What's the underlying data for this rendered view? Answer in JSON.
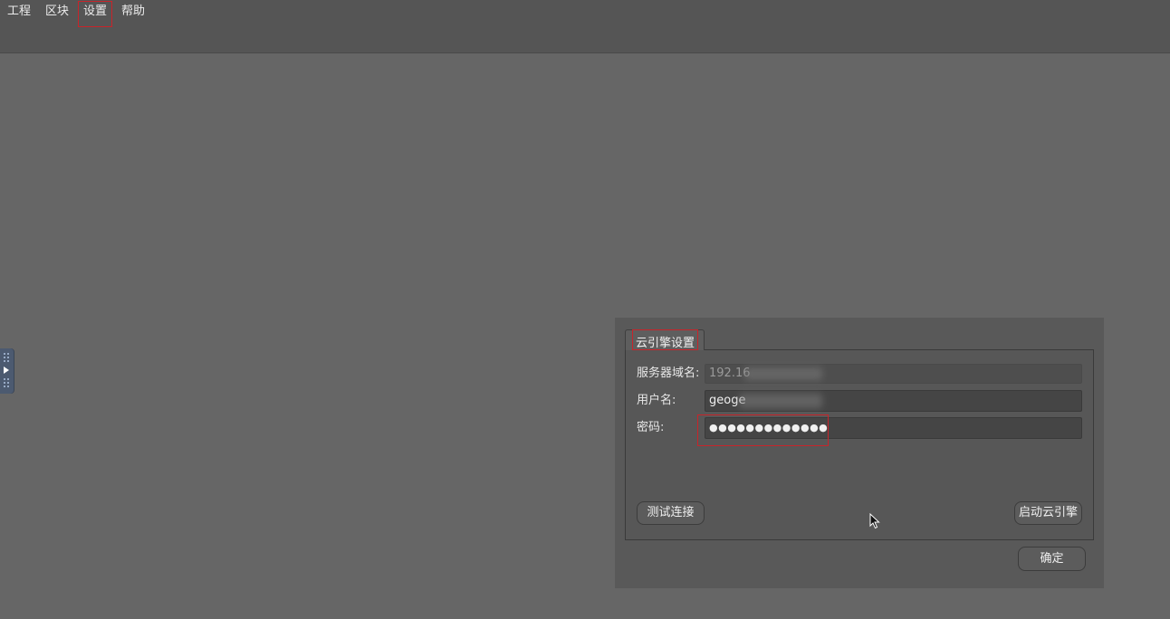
{
  "menubar": {
    "items": [
      {
        "label": "工程"
      },
      {
        "label": "区块"
      },
      {
        "label": "设置"
      },
      {
        "label": "帮助"
      }
    ]
  },
  "side_panel": {
    "icon": "expand-arrow-icon"
  },
  "dialog": {
    "tab_label": "云引擎设置",
    "fields": {
      "server": {
        "label": "服务器域名:",
        "value": "192.16"
      },
      "username": {
        "label": "用户名:",
        "value": "geoge"
      },
      "password": {
        "label": "密码:",
        "value": "●●●●●●●●●●●●●"
      }
    },
    "buttons": {
      "test_connection": "测试连接",
      "start_engine": "启动云引擎",
      "confirm": "确定"
    }
  },
  "colors": {
    "background": "#666666",
    "menubar": "#555555",
    "highlight": "#c8242a",
    "side_handle": "#4c5a70"
  }
}
